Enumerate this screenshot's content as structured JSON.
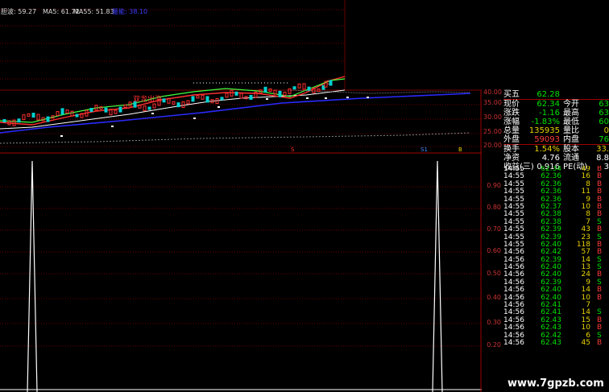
{
  "legend": {
    "first": "胆波: 59.27",
    "ma5": "MA5: 61.72",
    "ma55": "MA55: 51.83",
    "ma_other": "量能: 38.10"
  },
  "colors": {
    "ma5": "#ffffff",
    "ma55": "#ffffff",
    "ma_other": "#3040ff",
    "up": "#ff3030",
    "down": "#00e0e0",
    "grid": "#7a0000",
    "axis": "#c00000"
  },
  "price_axis": [
    "40.00",
    "35.00",
    "30.00",
    "25.00",
    "20.00"
  ],
  "indicator_axis": [
    "0.90",
    "0.80",
    "0.70",
    "0.60",
    "0.50",
    "0.40",
    "0.30",
    "0.20"
  ],
  "markers": [
    "S",
    "S1",
    "B"
  ],
  "annotation": "双龙出海",
  "quote": {
    "rows": [
      {
        "l1": "买五",
        "v1": "62.28",
        "l2": "",
        "v2": "",
        "c1": "grn",
        "c2": ""
      },
      {
        "l1": "现价",
        "v1": "62.34",
        "l2": "今开",
        "v2": "63",
        "c1": "grn",
        "c2": "grn"
      },
      {
        "l1": "涨跌",
        "v1": "-1.16",
        "l2": "最高",
        "v2": "63",
        "c1": "grn",
        "c2": "grn"
      },
      {
        "l1": "涨幅",
        "v1": "-1.83%",
        "l2": "最低",
        "v2": "60",
        "c1": "grn",
        "c2": "grn"
      },
      {
        "l1": "总量",
        "v1": "135935",
        "l2": "量比",
        "v2": "0",
        "c1": "yel",
        "c2": "yel"
      },
      {
        "l1": "外盘",
        "v1": "59093",
        "l2": "内盘",
        "v2": "76",
        "c1": "red",
        "c2": "grn"
      },
      {
        "l1": "换手",
        "v1": "1.54%",
        "l2": "股本",
        "v2": "33.",
        "c1": "yel",
        "c2": "yel"
      },
      {
        "l1": "净资",
        "v1": "4.76",
        "l2": "流通",
        "v2": "8.8",
        "c1": "g",
        "c2": "g"
      },
      {
        "l1": "收益(三)",
        "v1": "0.916",
        "l2": "PE(动)",
        "v2": "3",
        "c1": "g",
        "c2": "g"
      }
    ]
  },
  "ticks": [
    {
      "t": "14:55",
      "p": "62.34",
      "v": "49",
      "s": "B"
    },
    {
      "t": "14:55",
      "p": "62.36",
      "v": "16",
      "s": "B"
    },
    {
      "t": "14:55",
      "p": "62.36",
      "v": "8",
      "s": "B"
    },
    {
      "t": "14:55",
      "p": "62.36",
      "v": "11",
      "s": "B"
    },
    {
      "t": "14:55",
      "p": "62.36",
      "v": "9",
      "s": "B"
    },
    {
      "t": "14:55",
      "p": "62.37",
      "v": "10",
      "s": "B"
    },
    {
      "t": "14:55",
      "p": "62.38",
      "v": "8",
      "s": "B"
    },
    {
      "t": "14:55",
      "p": "62.38",
      "v": "7",
      "s": "S"
    },
    {
      "t": "14:55",
      "p": "62.39",
      "v": "43",
      "s": "B"
    },
    {
      "t": "14:55",
      "p": "62.39",
      "v": "23",
      "s": "S"
    },
    {
      "t": "14:55",
      "p": "62.40",
      "v": "118",
      "s": "B"
    },
    {
      "t": "14:56",
      "p": "62.42",
      "v": "57",
      "s": "B"
    },
    {
      "t": "14:56",
      "p": "62.39",
      "v": "14",
      "s": "S"
    },
    {
      "t": "14:56",
      "p": "62.40",
      "v": "13",
      "s": "S"
    },
    {
      "t": "14:56",
      "p": "62.40",
      "v": "24",
      "s": "B"
    },
    {
      "t": "14:56",
      "p": "62.39",
      "v": "9",
      "s": "S"
    },
    {
      "t": "14:56",
      "p": "62.40",
      "v": "14",
      "s": "B"
    },
    {
      "t": "14:56",
      "p": "62.40",
      "v": "10",
      "s": "B"
    },
    {
      "t": "14:56",
      "p": "62.41",
      "v": "7",
      "s": ""
    },
    {
      "t": "14:56",
      "p": "62.41",
      "v": "14",
      "s": "S"
    },
    {
      "t": "14:56",
      "p": "62.43",
      "v": "15",
      "s": "B"
    },
    {
      "t": "14:56",
      "p": "62.43",
      "v": "10",
      "s": "B"
    },
    {
      "t": "14:56",
      "p": "62.42",
      "v": "6",
      "s": "S"
    },
    {
      "t": "14:56",
      "p": "62.43",
      "v": "45",
      "s": "B"
    }
  ],
  "watermark": "www.7gpzb.com"
}
